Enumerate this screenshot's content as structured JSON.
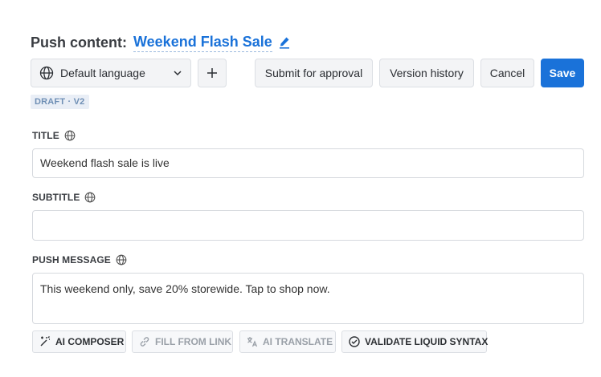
{
  "header": {
    "label": "Push content:",
    "name": "Weekend Flash Sale",
    "edit_icon": "pencil-icon"
  },
  "toolbar": {
    "language": "Default language",
    "add_label": "+",
    "submit_label": "Submit for approval",
    "history_label": "Version history",
    "cancel_label": "Cancel",
    "save_label": "Save"
  },
  "status_badge": "DRAFT · V2",
  "fields": {
    "title": {
      "label": "TITLE",
      "value": "Weekend flash sale is live"
    },
    "subtitle": {
      "label": "SUBTITLE",
      "value": ""
    },
    "push_message": {
      "label": "PUSH MESSAGE",
      "value": "This weekend only, save 20% storewide. Tap to shop now."
    }
  },
  "ai_tools": {
    "composer": "AI COMPOSER",
    "fill_from_link": "FILL FROM LINK",
    "translate": "AI TRANSLATE",
    "validate": "VALIDATE LIQUID SYNTAX"
  },
  "colors": {
    "accent": "#1a72d9",
    "badge_bg": "#e9eef6",
    "badge_text": "#6f8fb5"
  }
}
